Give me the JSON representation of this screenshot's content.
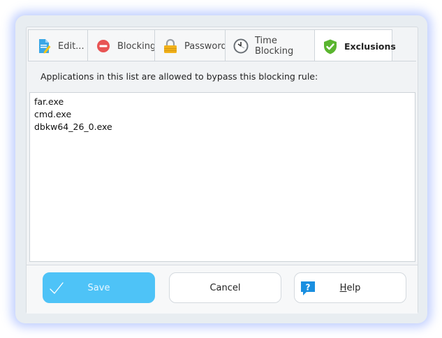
{
  "tabs": [
    {
      "label": "Edit...",
      "icon": "edit-icon"
    },
    {
      "label": "Blocking",
      "icon": "blocking-icon"
    },
    {
      "label": "Password",
      "icon": "padlock-icon"
    },
    {
      "label": "Time Blocking",
      "icon": "clock-icon"
    },
    {
      "label": "Exclusions",
      "icon": "shield-check-icon",
      "active": true
    }
  ],
  "exclusions": {
    "description": "Applications in this list are allowed to bypass this blocking rule:",
    "items": [
      "far.exe",
      "cmd.exe",
      "dbkw64_26_0.exe"
    ]
  },
  "buttons": {
    "save": "Save",
    "cancel": "Cancel",
    "help_prefix": "H",
    "help_rest": "elp"
  },
  "colors": {
    "accent": "#4ec3f7",
    "shield": "#5ab52f",
    "help_icon": "#1a8fe0"
  }
}
